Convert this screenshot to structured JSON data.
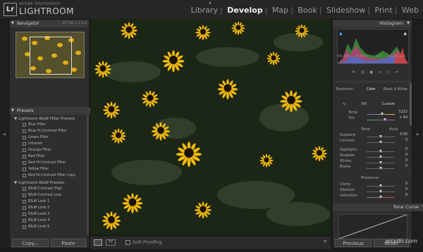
{
  "app": {
    "brand_small": "ADOBE PHOTOSHOP",
    "brand": "LIGHTROOM",
    "logo": "Lr"
  },
  "modules": [
    {
      "label": "Library",
      "active": false
    },
    {
      "label": "Develop",
      "active": true
    },
    {
      "label": "Map",
      "active": false
    },
    {
      "label": "Book",
      "active": false
    },
    {
      "label": "Slideshow",
      "active": false
    },
    {
      "label": "Print",
      "active": false
    },
    {
      "label": "Web",
      "active": false
    }
  ],
  "navigator": {
    "title": "Navigator",
    "options": "FIT  FILL  1:1  3:1"
  },
  "presets": {
    "title": "Presets",
    "add_label": "+",
    "groups": [
      {
        "label": "Lightroom B&W Filter Presets",
        "items": [
          "Blue Filter",
          "Blue Hi-Contrast Filter",
          "Green Filter",
          "Infrared",
          "Orange Filter",
          "Red Filter",
          "Red Hi-Contrast Filter",
          "Yellow Filter",
          "Red Hi-Contrast Filter copy"
        ]
      },
      {
        "label": "Lightroom B&W Presets",
        "items": [
          "B&W Contrast High",
          "B&W Contrast Low",
          "B&W Look 1",
          "B&W Look 2",
          "B&W Look 3",
          "B&W Look 4",
          "B&W Look 5"
        ]
      }
    ]
  },
  "left_buttons": {
    "copy": "Copy...",
    "paste": "Paste"
  },
  "toolbar": {
    "soft_proofing": "Soft Proofing"
  },
  "histogram": {
    "title": "Histogram",
    "iso": "ISO 400",
    "focal": "50 mm",
    "aperture": "ƒ / 8.0",
    "shutter": "1/1250 sec"
  },
  "basic": {
    "treatment_label": "Treatment :",
    "treatment_color": "Color",
    "treatment_bw": "Black & White",
    "wb_label": "WB :",
    "wb_value": "Custom",
    "temp_label": "Temp",
    "temp_value": "5222",
    "tint_label": "Tint",
    "tint_value": "+ 44",
    "tone_label": "Tone",
    "tone_auto": "Auto",
    "exposure_label": "Exposure",
    "exposure_value": "0.00",
    "contrast_label": "Contrast",
    "contrast_value": "0",
    "highlights_label": "Highlights",
    "highlights_value": "0",
    "shadows_label": "Shadows",
    "shadows_value": "0",
    "whites_label": "Whites",
    "whites_value": "0",
    "blacks_label": "Blacks",
    "blacks_value": "0",
    "presence_label": "Presence",
    "clarity_label": "Clarity",
    "clarity_value": "0",
    "vibrance_label": "Vibrance",
    "vibrance_value": "0",
    "saturation_label": "Saturation",
    "saturation_value": "0"
  },
  "tone_curve": {
    "title": "Tone Curve"
  },
  "right_buttons": {
    "previous": "Previous",
    "reset": "Reset"
  },
  "watermark": "wsxdn.com",
  "colors": {
    "accent_flower": "#f2b90e",
    "panel": "#2e2e2e",
    "header": "#262626"
  }
}
